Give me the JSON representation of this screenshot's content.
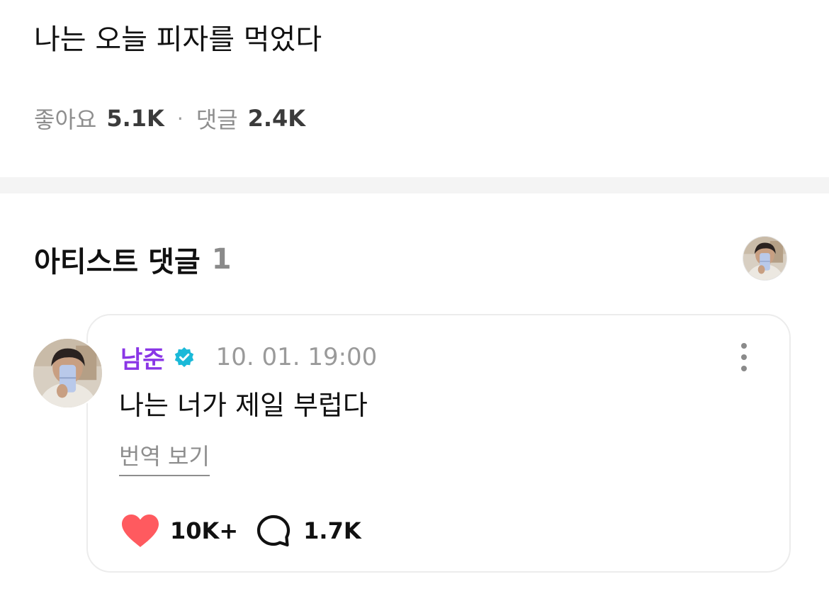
{
  "post": {
    "text": "나는 오늘 피자를 먹었다",
    "likes_label": "좋아요",
    "likes_count": "5.1K",
    "separator": "·",
    "comments_label": "댓글",
    "comments_count": "2.4K"
  },
  "artist_comments": {
    "title": "아티스트 댓글",
    "count": "1",
    "header_avatar_icon": "artist-avatar"
  },
  "comment": {
    "author": "남준",
    "verified": true,
    "date": "10. 01. 19:00",
    "text": "나는 너가 제일 부럽다",
    "translate_label": "번역 보기",
    "likes": "10K+",
    "replies": "1.7K",
    "icons": {
      "more": "more-vertical-icon",
      "like": "heart-icon",
      "reply": "speech-bubble-icon",
      "verified": "verified-check-icon"
    }
  },
  "colors": {
    "author_name": "#8a36e6",
    "verified_badge": "#1ab9d8",
    "heart": "#ff5a5f",
    "muted_text": "#8e8e8e",
    "divider": "#f4f4f4",
    "card_border": "#ececec"
  }
}
